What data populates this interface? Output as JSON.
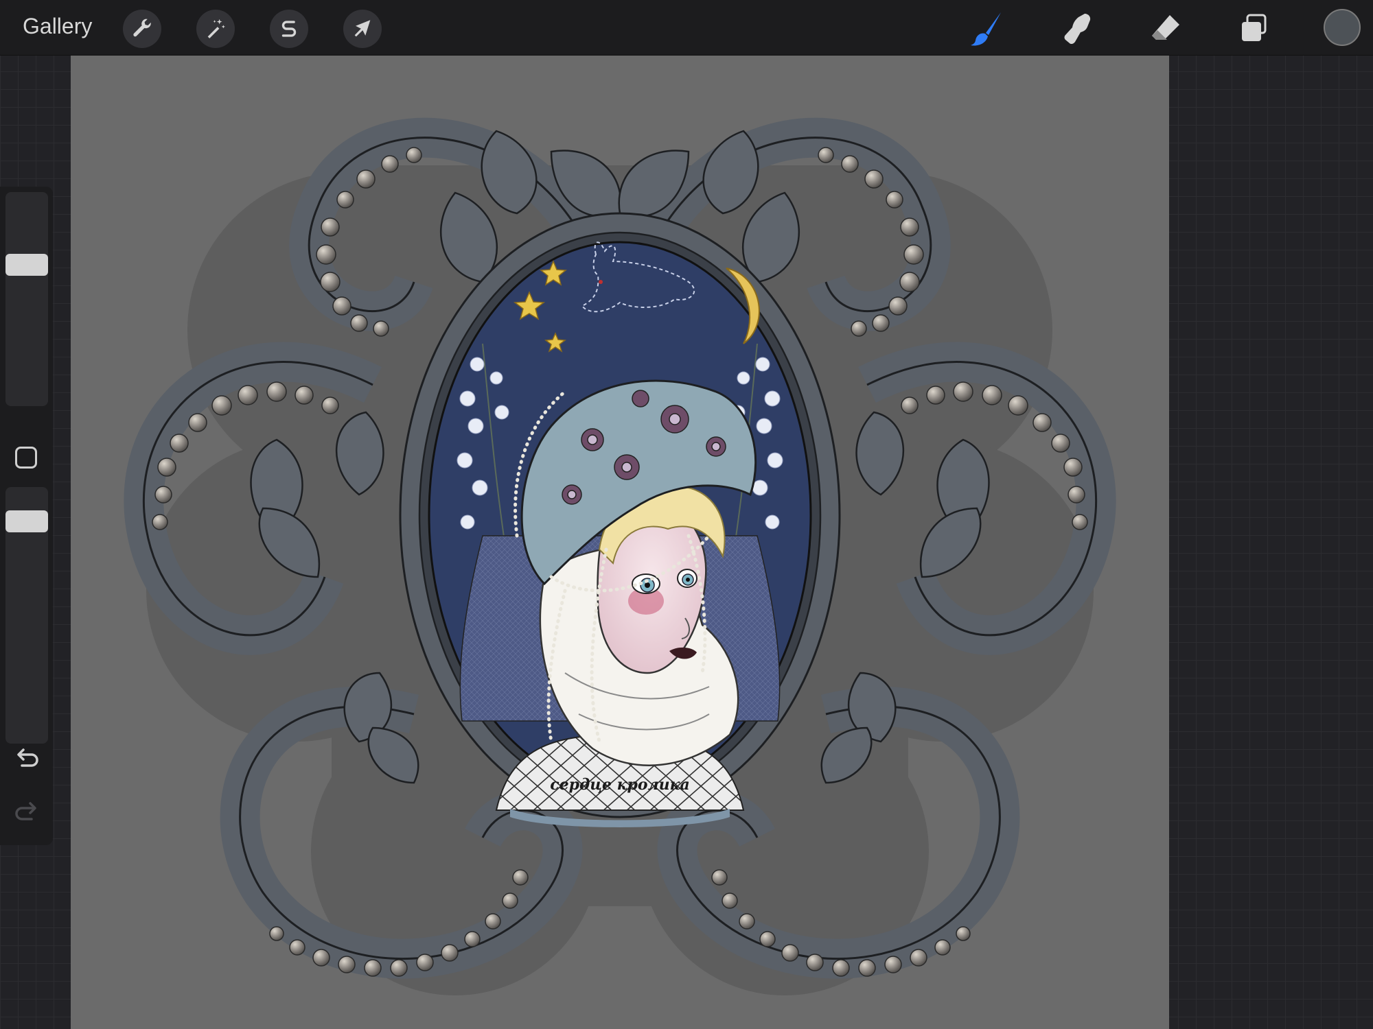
{
  "topbar": {
    "gallery_label": "Gallery",
    "left_tools": [
      {
        "name": "actions",
        "icon": "wrench-icon"
      },
      {
        "name": "adjustments",
        "icon": "magic-wand-icon"
      },
      {
        "name": "selection",
        "icon": "selection-s-icon"
      },
      {
        "name": "transform",
        "icon": "arrow-cursor-icon"
      }
    ],
    "right_tools": [
      {
        "name": "brush",
        "icon": "brush-icon",
        "active": true,
        "color": "#2f7cf6"
      },
      {
        "name": "smudge",
        "icon": "smudge-finger-icon",
        "active": false
      },
      {
        "name": "eraser",
        "icon": "eraser-icon",
        "active": false
      },
      {
        "name": "layers",
        "icon": "layers-icon",
        "active": false
      }
    ],
    "current_color": "#4d5257"
  },
  "sidebar": {
    "brush_size_level": 0.68,
    "opacity_level": 0.9,
    "modify_icon": "square-icon",
    "undo_icon": "undo-arrow-icon",
    "redo_icon": "redo-arrow-icon"
  },
  "artwork": {
    "caption": "сердце кролика",
    "background_color": "#6b6b6b",
    "frame_color": "#5a6068",
    "oval_background": "#2f3e66"
  }
}
